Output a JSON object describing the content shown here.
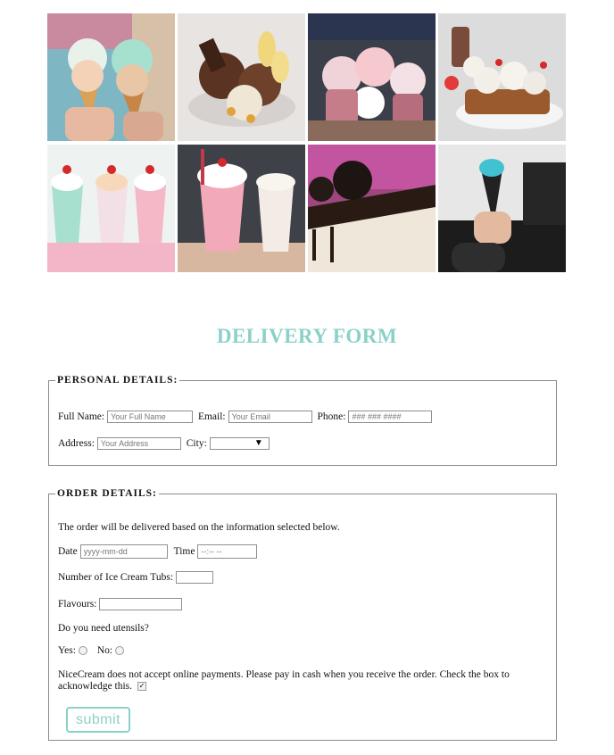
{
  "gallery": {
    "images": [
      {
        "icon": "ice-cream-cones-photo"
      },
      {
        "icon": "chocolate-sundae-photo"
      },
      {
        "icon": "ice-cream-cups-photo"
      },
      {
        "icon": "waffle-sundaes-photo"
      },
      {
        "icon": "milkshakes-photo"
      },
      {
        "icon": "strawberry-milkshake-photo"
      },
      {
        "icon": "oreo-ice-cream-cake-photo"
      },
      {
        "icon": "black-cone-photo"
      }
    ]
  },
  "title": "DELIVERY FORM",
  "personal": {
    "legend": "PERSONAL DETAILS:",
    "full_name_label": "Full Name:",
    "full_name_placeholder": "Your Full Name",
    "email_label": "Email:",
    "email_placeholder": "Your Email",
    "phone_label": "Phone:",
    "phone_placeholder": "### ### ####",
    "address_label": "Address:",
    "address_placeholder": "Your Address",
    "city_label": "City:",
    "city_value": ""
  },
  "order": {
    "legend": "ORDER DETAILS:",
    "intro": "The order will be delivered based on the information selected below.",
    "date_label": "Date",
    "date_placeholder": "yyyy-mm-dd",
    "time_label": "Time",
    "time_placeholder": "--:-- --",
    "tubs_label": "Number of Ice Cream Tubs:",
    "flavours_label": "Flavours:",
    "utensils_question": "Do you need utensils?",
    "yes_label": "Yes:",
    "no_label": "No:",
    "payment_note": "NiceCream does not accept online payments. Please pay in cash when you receive the order. Check the box to acknowledge this.",
    "acknowledge_checked": "✓",
    "submit_label": "submit"
  },
  "colors": {
    "accent": "#8ad1c9",
    "border": "#8a8a8a"
  }
}
